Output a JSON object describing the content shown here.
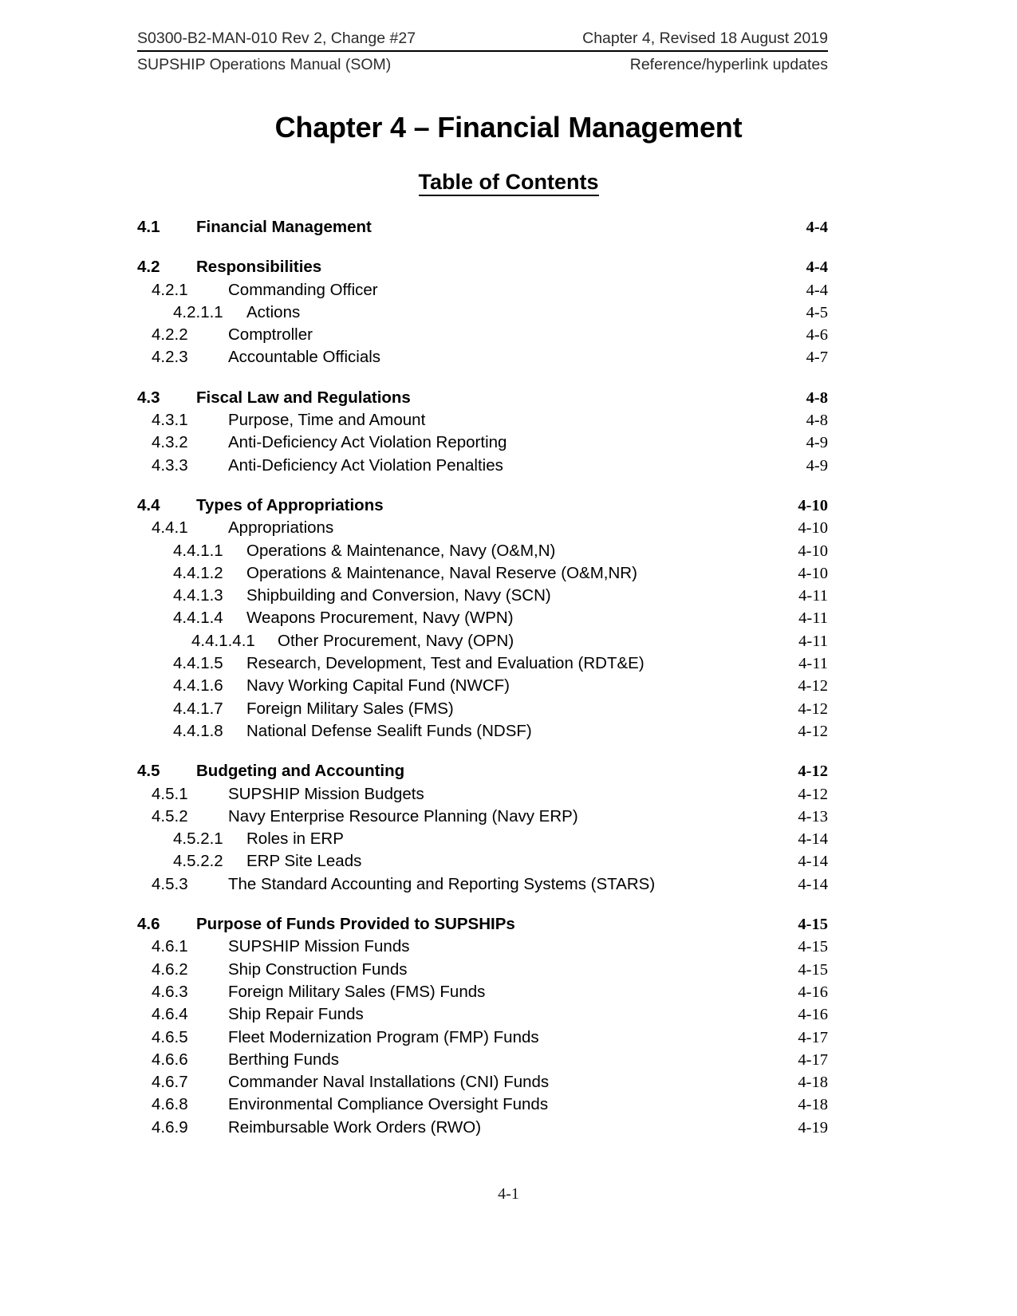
{
  "header": {
    "left_top": "S0300-B2-MAN-010 Rev 2, Change #27",
    "right_top": "Chapter 4, Revised 18 August 2019",
    "left_bottom": "SUPSHIP Operations Manual (SOM)",
    "right_bottom": "Reference/hyperlink updates"
  },
  "chapter_title": "Chapter 4 – Financial Management",
  "toc_title": "Table of Contents",
  "footer": {
    "page_label": "4-1"
  },
  "toc": {
    "entries": [
      {
        "level": 1,
        "number": "4.1",
        "label": "Financial Management",
        "page": "4-4"
      },
      {
        "level": 1,
        "number": "4.2",
        "label": "Responsibilities",
        "page": "4-4"
      },
      {
        "level": 2,
        "number": "4.2.1",
        "label": "Commanding Officer",
        "page": "4-4"
      },
      {
        "level": 3,
        "number": "4.2.1.1",
        "label": "Actions",
        "page": "4-5"
      },
      {
        "level": 2,
        "number": "4.2.2",
        "label": "Comptroller",
        "page": "4-6"
      },
      {
        "level": 2,
        "number": "4.2.3",
        "label": "Accountable Officials",
        "page": "4-7"
      },
      {
        "level": 1,
        "number": "4.3",
        "label": "Fiscal Law and Regulations",
        "page": "4-8"
      },
      {
        "level": 2,
        "number": "4.3.1",
        "label": "Purpose, Time and Amount",
        "page": "4-8"
      },
      {
        "level": 2,
        "number": "4.3.2",
        "label": "Anti-Deficiency Act Violation Reporting",
        "page": "4-9"
      },
      {
        "level": 2,
        "number": "4.3.3",
        "label": "Anti-Deficiency Act Violation Penalties",
        "page": "4-9"
      },
      {
        "level": 1,
        "number": "4.4",
        "label": "Types of Appropriations",
        "page": "4-10"
      },
      {
        "level": 2,
        "number": "4.4.1",
        "label": "Appropriations",
        "page": "4-10"
      },
      {
        "level": 3,
        "number": "4.4.1.1",
        "label": "Operations & Maintenance, Navy (O&M,N)",
        "page": "4-10"
      },
      {
        "level": 3,
        "number": "4.4.1.2",
        "label": "Operations & Maintenance, Naval Reserve (O&M,NR)",
        "page": "4-10"
      },
      {
        "level": 3,
        "number": "4.4.1.3",
        "label": "Shipbuilding and Conversion, Navy (SCN)",
        "page": "4-11"
      },
      {
        "level": 3,
        "number": "4.4.1.4",
        "label": "Weapons Procurement, Navy (WPN)",
        "page": "4-11"
      },
      {
        "level": 4,
        "number": "4.4.1.4.1",
        "label": "Other Procurement, Navy (OPN)",
        "page": "4-11"
      },
      {
        "level": 3,
        "number": "4.4.1.5",
        "label": "Research, Development, Test and Evaluation (RDT&E)",
        "page": "4-11"
      },
      {
        "level": 3,
        "number": "4.4.1.6",
        "label": "Navy Working Capital Fund (NWCF)",
        "page": "4-12"
      },
      {
        "level": 3,
        "number": "4.4.1.7",
        "label": "Foreign Military Sales (FMS)",
        "page": "4-12"
      },
      {
        "level": 3,
        "number": "4.4.1.8",
        "label": "National Defense Sealift Funds (NDSF)",
        "page": "4-12"
      },
      {
        "level": 1,
        "number": "4.5",
        "label": "Budgeting and Accounting",
        "page": "4-12"
      },
      {
        "level": 2,
        "number": "4.5.1",
        "label": "SUPSHIP Mission Budgets",
        "page": "4-12"
      },
      {
        "level": 2,
        "number": "4.5.2",
        "label": "Navy Enterprise Resource Planning (Navy ERP)",
        "page": "4-13"
      },
      {
        "level": 3,
        "number": "4.5.2.1",
        "label": "Roles in ERP",
        "page": "4-14"
      },
      {
        "level": 3,
        "number": "4.5.2.2",
        "label": "ERP Site Leads",
        "page": "4-14"
      },
      {
        "level": 2,
        "number": "4.5.3",
        "label": "The Standard Accounting and Reporting Systems (STARS)",
        "page": "4-14"
      },
      {
        "level": 1,
        "number": "4.6",
        "label": "Purpose of Funds Provided to SUPSHIPs",
        "page": "4-15"
      },
      {
        "level": 2,
        "number": "4.6.1",
        "label": "SUPSHIP Mission Funds",
        "page": "4-15"
      },
      {
        "level": 2,
        "number": "4.6.2",
        "label": "Ship Construction Funds",
        "page": "4-15"
      },
      {
        "level": 2,
        "number": "4.6.3",
        "label": "Foreign Military Sales (FMS) Funds",
        "page": "4-16"
      },
      {
        "level": 2,
        "number": "4.6.4",
        "label": "Ship Repair Funds",
        "page": "4-16"
      },
      {
        "level": 2,
        "number": "4.6.5",
        "label": "Fleet Modernization Program (FMP) Funds",
        "page": "4-17"
      },
      {
        "level": 2,
        "number": "4.6.6",
        "label": "Berthing Funds",
        "page": "4-17"
      },
      {
        "level": 2,
        "number": "4.6.7",
        "label": "Commander Naval Installations (CNI) Funds",
        "page": "4-18"
      },
      {
        "level": 2,
        "number": "4.6.8",
        "label": "Environmental Compliance Oversight Funds",
        "page": "4-18"
      },
      {
        "level": 2,
        "number": "4.6.9",
        "label": "Reimbursable Work Orders (RWO)",
        "page": "4-19"
      }
    ]
  }
}
